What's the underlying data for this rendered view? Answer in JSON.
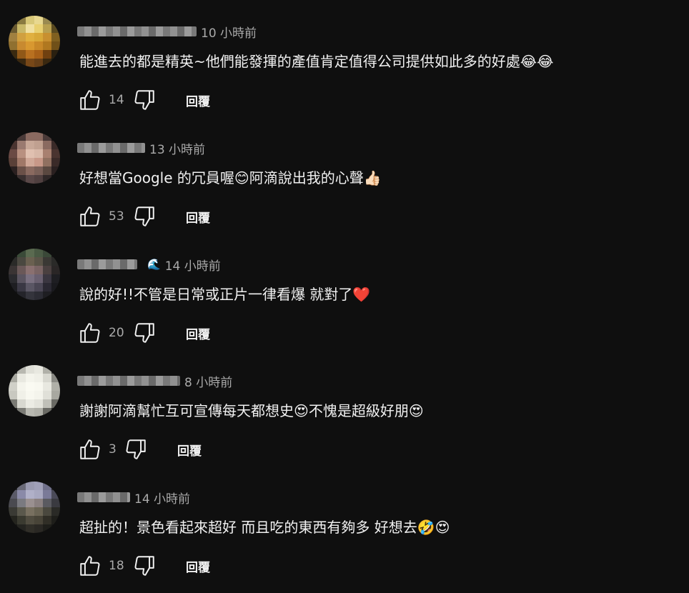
{
  "comments": [
    {
      "time": "10 小時前",
      "text": "能進去的都是精英~他們能發揮的產值肯定值得公司提供如此多的好處😂😂",
      "likes": "14",
      "reply_label": "回覆",
      "has_badge": false
    },
    {
      "time": "13 小時前",
      "text": "好想當Google 的冗員喔😊阿滴說出我的心聲👍🏻",
      "likes": "53",
      "reply_label": "回覆",
      "has_badge": false
    },
    {
      "time": "14 小時前",
      "text": "說的好!!不管是日常或正片一律看爆 就對了❤️",
      "likes": "20",
      "reply_label": "回覆",
      "has_badge": true,
      "badge_icon": "🌊"
    },
    {
      "time": "8 小時前",
      "text": "謝謝阿滴幫忙互可宣傳每天都想史😍不愧是超級好朋😍",
      "likes": "3",
      "reply_label": "回覆",
      "has_badge": false
    },
    {
      "time": "14 小時前",
      "text": "超扯的！景色看起來超好 而且吃的東西有夠多 好想去🤣😍",
      "likes": "18",
      "reply_label": "回覆",
      "has_badge": false
    }
  ]
}
